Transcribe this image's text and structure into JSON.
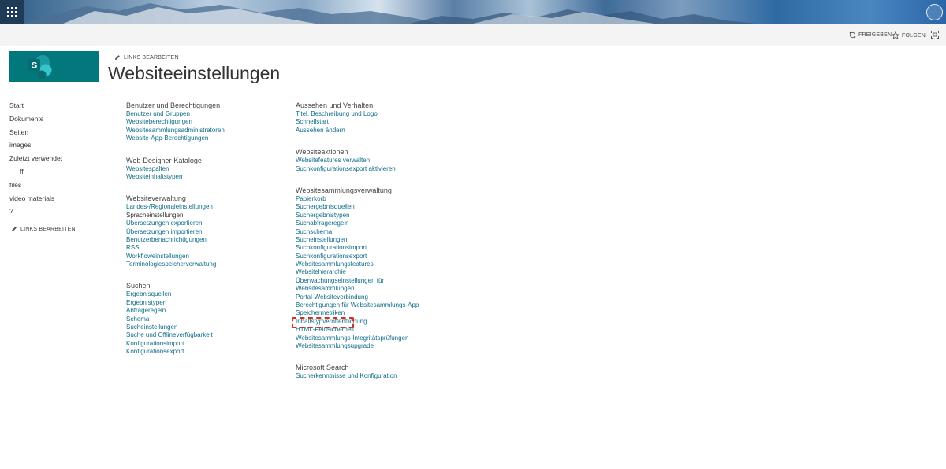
{
  "header": {
    "share_label": "FREIGEBEN",
    "follow_label": "FOLGEN"
  },
  "logo": {
    "letter": "S"
  },
  "edit_links_label": "LINKS BEARBEITEN",
  "page_title": "Websiteeinstellungen",
  "quick_launch": [
    {
      "label": "Start"
    },
    {
      "label": "Dokumente"
    },
    {
      "label": "Seiten"
    },
    {
      "label": "images"
    },
    {
      "label": "Zuletzt verwendet"
    },
    {
      "label": "ff"
    },
    {
      "label": "files"
    },
    {
      "label": "video materials"
    },
    {
      "label": "?"
    }
  ],
  "left_sections": [
    {
      "title": "Benutzer und Berechtigungen",
      "links": [
        "Benutzer und Gruppen",
        "Websiteberechtigungen",
        "Websitesammlungsadministratoren",
        "Website-App-Berechtigungen"
      ]
    },
    {
      "title": "Web-Designer-Kataloge",
      "links": [
        "Websitespalten",
        "Websiteinhaltstypen"
      ]
    },
    {
      "title": "Websiteverwaltung",
      "links": [
        "Landes-/Regionaleinstellungen",
        "Spracheinstellungen",
        "Übersetzungen exportieren",
        "Übersetzungen importieren",
        "Benutzerbenachrichtigungen",
        "RSS",
        "Workfloweinstellungen",
        "Terminologiespeicherverwaltung"
      ]
    },
    {
      "title": "Suchen",
      "links": [
        "Ergebnisquellen",
        "Ergebnistypen",
        "Abfrageregeln",
        "Schema",
        "Sucheinstellungen",
        "Suche und Offlineverfügbarkeit",
        "Konfigurationsimport",
        "Konfigurationsexport"
      ]
    }
  ],
  "right_sections": [
    {
      "title": "Aussehen und Verhalten",
      "links": [
        "Titel, Beschreibung und Logo",
        "Schnellstart",
        "Aussehen ändern"
      ]
    },
    {
      "title": "Websiteaktionen",
      "links": [
        "Websitefeatures verwalten",
        "Suchkonfigurationsexport aktivieren"
      ]
    },
    {
      "title": "Websitesammlungsverwaltung",
      "links": [
        "Papierkorb",
        "Suchergebnisquellen",
        "Suchergebnistypen",
        "Suchabfrageregeln",
        "Suchschema",
        "Sucheinstellungen",
        "Suchkonfigurationsimport",
        "Suchkonfigurationsexport",
        "Websitesammlungsfeatures",
        "Websitehierarchie",
        "Überwachungseinstellungen für",
        "Websitesammlungen",
        "Portal-Websiteverbindung",
        "Berechtigungen für Websitesammlungs-App",
        "Speichermetriken",
        "Inhaltstypveröffentlichung",
        "HTML-Feldsicherheit",
        "Websitesammlungs-Integritätsprüfungen",
        "Websitesammlungsupgrade"
      ]
    },
    {
      "title": "Microsoft Search",
      "links": [
        "Sucherkenntnisse und Konfiguration"
      ]
    }
  ],
  "colors": {
    "accent": "#03787c",
    "link": "#0f6c8a",
    "highlight": "#d63120"
  }
}
